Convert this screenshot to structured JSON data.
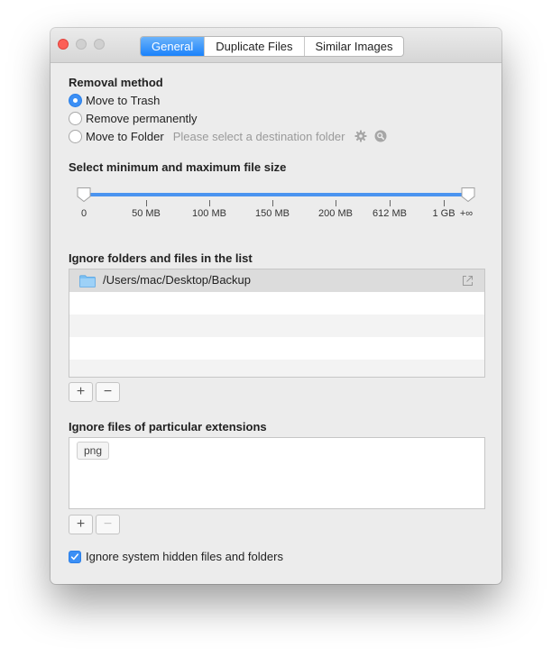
{
  "window": {
    "tabs": [
      {
        "label": "General",
        "active": true
      },
      {
        "label": "Duplicate Files",
        "active": false
      },
      {
        "label": "Similar Images",
        "active": false
      }
    ]
  },
  "removal": {
    "title": "Removal method",
    "options": [
      {
        "label": "Move to Trash",
        "selected": true
      },
      {
        "label": "Remove permanently",
        "selected": false
      },
      {
        "label": "Move to Folder",
        "selected": false
      }
    ],
    "folder_placeholder": "Please select a destination folder",
    "icons": [
      "gear-icon",
      "magnifier-icon"
    ]
  },
  "file_size": {
    "title": "Select minimum and maximum file size",
    "ticks": [
      "0",
      "50 MB",
      "100 MB",
      "150 MB",
      "200 MB",
      "612 MB",
      "1 GB",
      "+∞"
    ],
    "min_value": "0",
    "max_value": "+∞",
    "accent_color": "#4a94f0"
  },
  "ignore_folders": {
    "title": "Ignore folders and files in the list",
    "items": [
      {
        "path": "/Users/mac/Desktop/Backup",
        "icon": "folder-icon"
      }
    ],
    "add_label": "+",
    "remove_label": "−"
  },
  "ignore_extensions": {
    "title": "Ignore files of particular extensions",
    "tokens": [
      "png"
    ],
    "add_label": "+",
    "remove_label": "−"
  },
  "hidden_files": {
    "label": "Ignore system hidden files and folders",
    "checked": true
  }
}
